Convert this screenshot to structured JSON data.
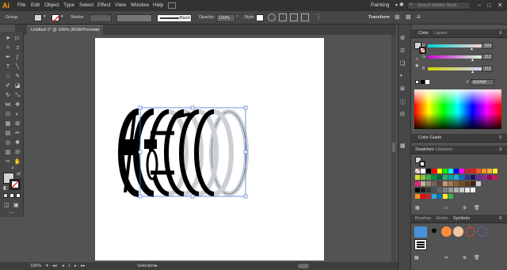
{
  "app": {
    "logo": "Ai"
  },
  "menu": [
    "File",
    "Edit",
    "Object",
    "Type",
    "Select",
    "Effect",
    "View",
    "Window",
    "Help"
  ],
  "workspace": {
    "label": "Painting",
    "dropdown_icon": "chevron-down-icon"
  },
  "search": {
    "placeholder": "Search Adobe Stock"
  },
  "window_controls": {
    "minimize": "–",
    "maximize": "□",
    "close": "✕"
  },
  "control_bar": {
    "selection_label": "Group",
    "stroke_label": "Stroke:",
    "brush_label": "Basic",
    "opacity_label": "Opacity:",
    "opacity_value": "100%",
    "style_label": "Style:",
    "transform_label": "Transform"
  },
  "document_tab": {
    "title": "Untitled-1* @ 106% (RGB/Preview)",
    "close": "×"
  },
  "status_bar": {
    "zoom": "106%",
    "artboard_number": "1",
    "tool_name": "Selection"
  },
  "color_panel": {
    "tabs": [
      "Color",
      "Layers"
    ],
    "channels": [
      {
        "label": "R",
        "value": "209",
        "position": 0.82
      },
      {
        "label": "G",
        "value": "212",
        "position": 0.83
      },
      {
        "label": "B",
        "value": "212",
        "position": 0.83
      }
    ],
    "hex_label": "#",
    "hex_value": "d1d4d4",
    "fill_color": "#d1d4d4"
  },
  "color_guide": {
    "title": "Color Guide"
  },
  "swatches_panel": {
    "tabs": [
      "Swatches",
      "Libraries"
    ]
  },
  "symbols_panel": {
    "tabs": [
      "Brushes",
      "Stroke",
      "Symbols"
    ]
  },
  "colors": {
    "menu_bg": "#323232",
    "panel_bg": "#535353",
    "accent_logo": "#ff9a00",
    "selection_blue": "#4a7bd6",
    "ring_fill_back": "#cbd0d6"
  }
}
